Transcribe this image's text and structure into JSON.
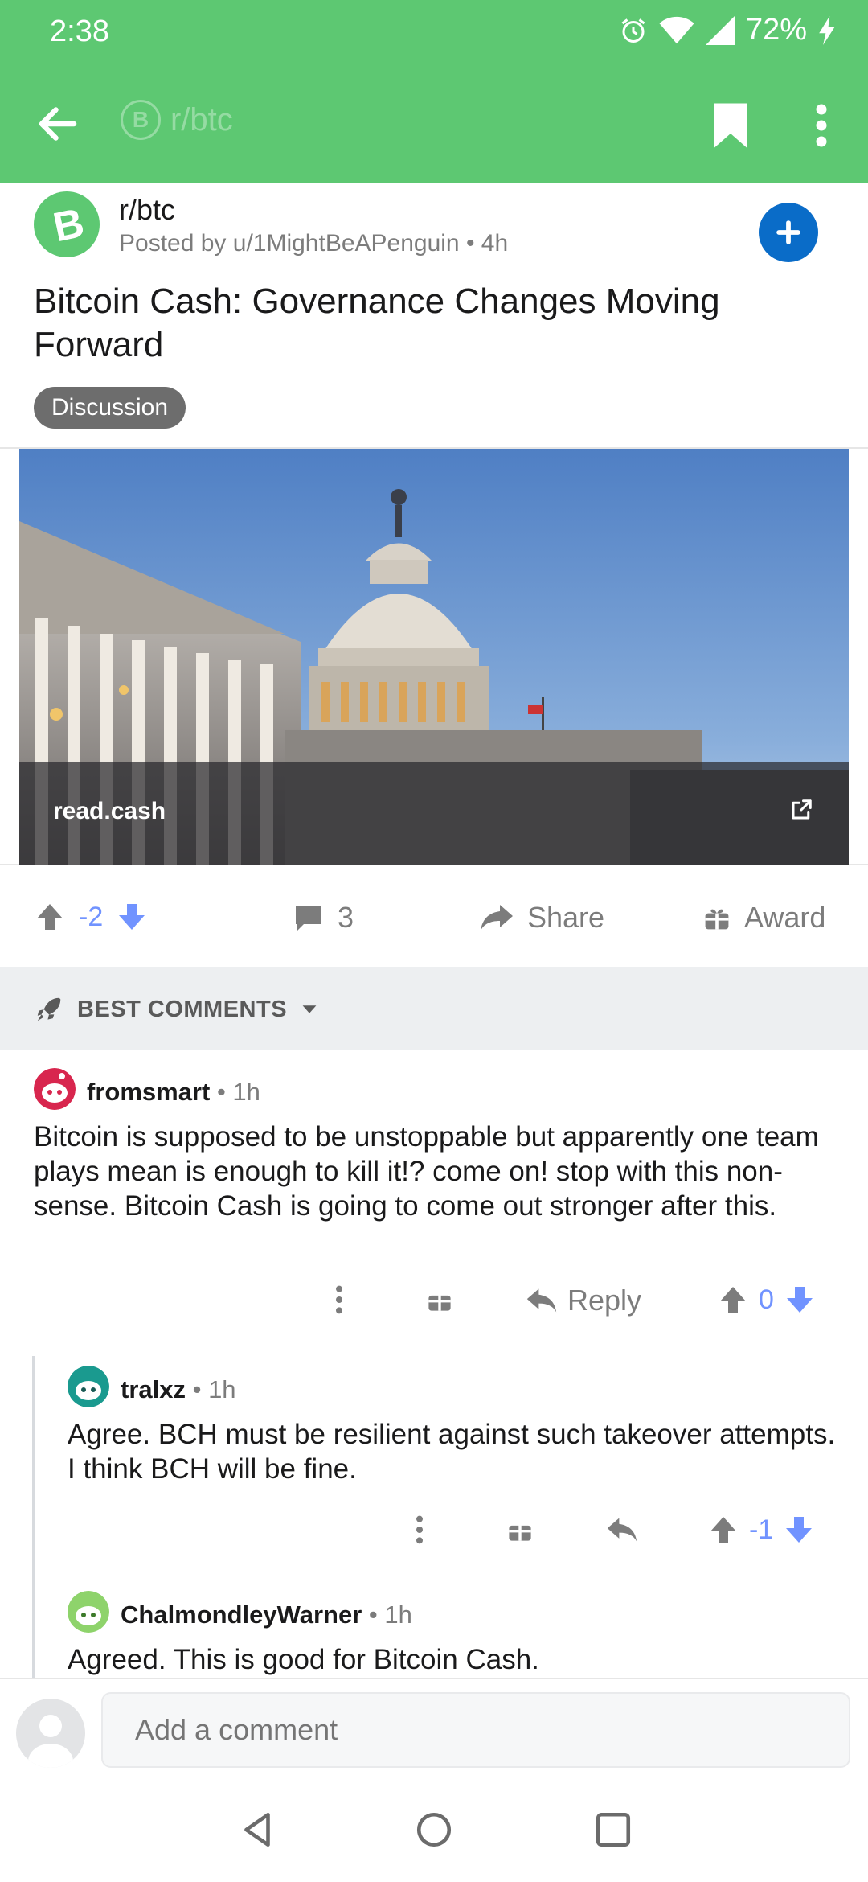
{
  "status_bar": {
    "time": "2:38",
    "battery": "72%"
  },
  "app_bar": {
    "subreddit_title": "r/btc"
  },
  "post": {
    "subreddit": "r/btc",
    "meta": "Posted by u/1MightBeAPenguin • 4h",
    "title": "Bitcoin Cash: Governance Changes Moving Forward",
    "flair": "Discussion",
    "link_domain": "read.cash",
    "score": "-2",
    "comment_count": "3",
    "share_label": "Share",
    "award_label": "Award"
  },
  "sort": {
    "label": "BEST COMMENTS"
  },
  "comments": [
    {
      "author": "fromsmart",
      "time": " • 1h",
      "body": "Bitcoin is supposed to be unstoppable but apparently one team plays mean is enough to kill it!?  come on! stop with this non-sense. Bitcoin Cash is going to come out stronger after this.",
      "reply_label": "Reply",
      "score": "0"
    },
    {
      "author": "tralxz",
      "time": " • 1h",
      "body": "Agree. BCH must be resilient against such takeover attempts. I think BCH will be fine.",
      "score": "-1"
    },
    {
      "author": "ChalmondleyWarner",
      "time": " • 1h",
      "body": "Agreed. This is good for Bitcoin Cash."
    }
  ],
  "composer": {
    "placeholder": "Add a comment"
  },
  "colors": {
    "brand_green": "#5dc872",
    "upvote_blue": "#7193ff",
    "join_blue": "#0a6cc8"
  }
}
